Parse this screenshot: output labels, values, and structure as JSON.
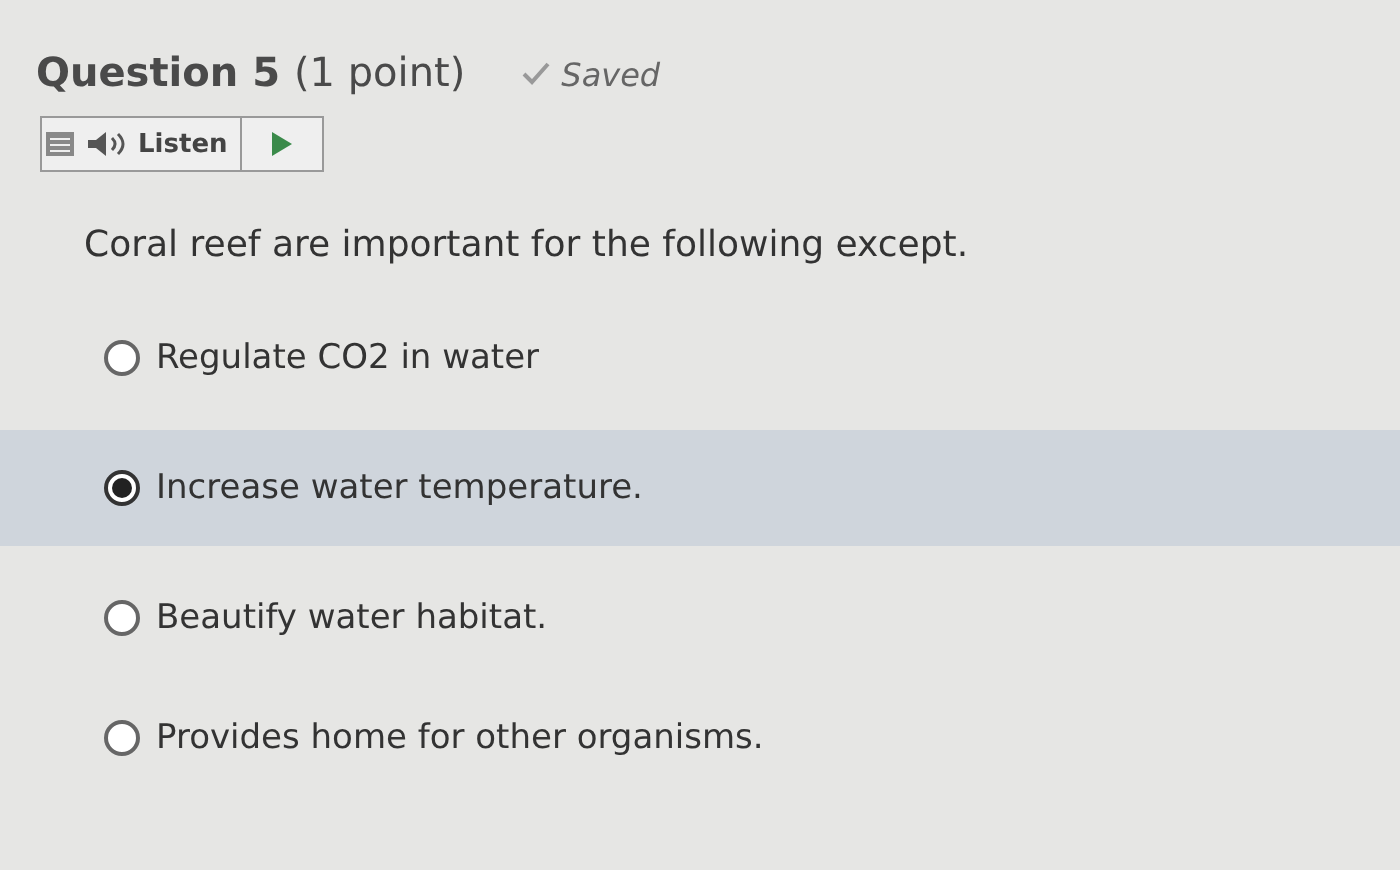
{
  "question": {
    "title": "Question 5",
    "points": "(1 point)",
    "status": "Saved",
    "saved": true
  },
  "listen": {
    "label": "Listen"
  },
  "prompt": "Coral reef are important for the following except.",
  "options": [
    {
      "label": "Regulate CO2 in water",
      "selected": false
    },
    {
      "label": "Increase water temperature.",
      "selected": true
    },
    {
      "label": "Beautify water habitat.",
      "selected": false
    },
    {
      "label": "Provides home for other organisms.",
      "selected": false
    }
  ]
}
